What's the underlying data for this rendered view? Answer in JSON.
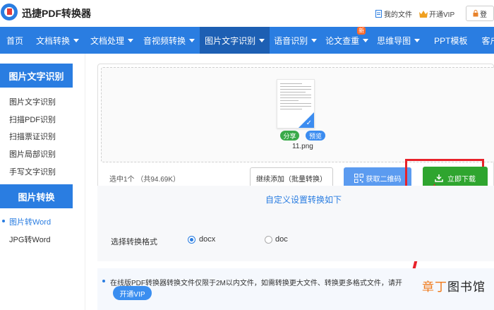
{
  "header": {
    "brand": "迅捷PDF转换器",
    "my_files": "我的文件",
    "vip": "开通VIP",
    "login": "登"
  },
  "nav": {
    "items": [
      {
        "label": "首页",
        "has_caret": false
      },
      {
        "label": "文档转换",
        "has_caret": true
      },
      {
        "label": "文档处理",
        "has_caret": true
      },
      {
        "label": "音视频转换",
        "has_caret": true
      },
      {
        "label": "图片文字识别",
        "has_caret": true
      },
      {
        "label": "语音识别",
        "has_caret": true
      },
      {
        "label": "论文查重",
        "has_caret": true
      },
      {
        "label": "思维导图",
        "has_caret": true
      },
      {
        "label": "PPT模板",
        "has_caret": false
      },
      {
        "label": "客户端",
        "has_caret": true
      }
    ],
    "new_badge": "新"
  },
  "sidebar": {
    "section1_title": "图片文字识别",
    "section1_items": [
      "图片文字识别",
      "扫描PDF识别",
      "扫描票证识别",
      "图片局部识别",
      "手写文字识别"
    ],
    "section2_title": "图片转换",
    "section2_items": [
      "图片转Word",
      "JPG转Word"
    ]
  },
  "upload": {
    "share": "分享",
    "preview": "预览",
    "filename": "11.png",
    "selected_info": "选中1个 （共94.69K）",
    "add_more": "继续添加（批量转换）",
    "qr": "获取二维码",
    "download": "立即下载"
  },
  "settings": {
    "title": "自定义设置转换如下",
    "format_label": "选择转换格式",
    "options": [
      "docx",
      "doc"
    ],
    "selected": "docx"
  },
  "notice": {
    "text": "在线版PDF转换器转换文件仅限于2M以内文件，如需转换更大文件、转换更多格式文件，请开",
    "vip_button": "开通VIP"
  },
  "watermark": {
    "part1": "章丁",
    "part2": "图书馆"
  },
  "colors": {
    "primary": "#2a7de1",
    "download": "#2fa52f",
    "highlight": "#e8222a"
  }
}
